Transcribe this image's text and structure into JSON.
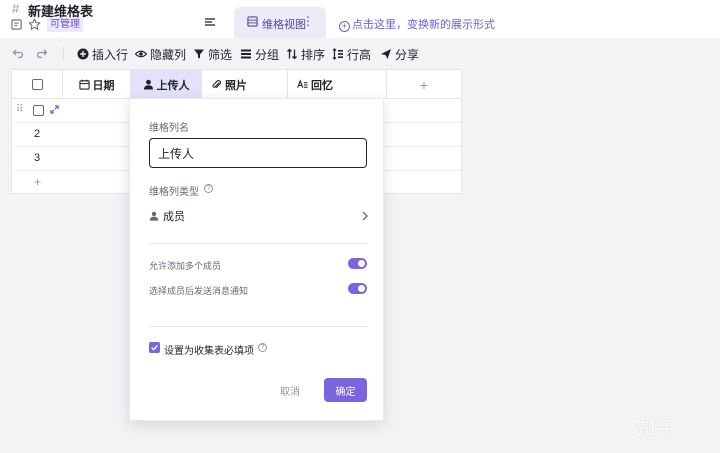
{
  "header": {
    "title": "新建维格表",
    "permission_badge": "可管理",
    "view_tab_label": "维格视图",
    "view_tab_more": "⋮",
    "switch_hint": "点击这里，变换新的展示形式"
  },
  "toolbar": {
    "insert_row": "插入行",
    "hide_columns": "隐藏列",
    "filter": "筛选",
    "group": "分组",
    "sort": "排序",
    "row_height": "行高",
    "share": "分享"
  },
  "grid": {
    "columns": [
      {
        "label": "日期",
        "icon": "calendar-icon"
      },
      {
        "label": "上传人",
        "icon": "person-icon"
      },
      {
        "label": "照片",
        "icon": "attachment-icon"
      },
      {
        "label": "回忆",
        "icon": "text-icon"
      }
    ],
    "add_column": "+",
    "rows": [
      {
        "number": ""
      },
      {
        "number": "2"
      },
      {
        "number": "3"
      }
    ],
    "add_row": "+"
  },
  "popup": {
    "name_label": "维格列名",
    "name_value": "上传人",
    "type_label": "维格列类型",
    "type_value": "成员",
    "option_multiple": "允许添加多个成员",
    "option_notify": "选择成员后发送消息通知",
    "option_multiple_on": true,
    "option_notify_on": true,
    "required_label": "设置为收集表必填项",
    "required_checked": true,
    "cancel": "取消",
    "confirm": "确定"
  },
  "watermark": "知乎",
  "colors": {
    "accent": "#7b64e0",
    "active_column_bg": "#e3e1fb",
    "view_tab_bg": "#ecebf7"
  }
}
